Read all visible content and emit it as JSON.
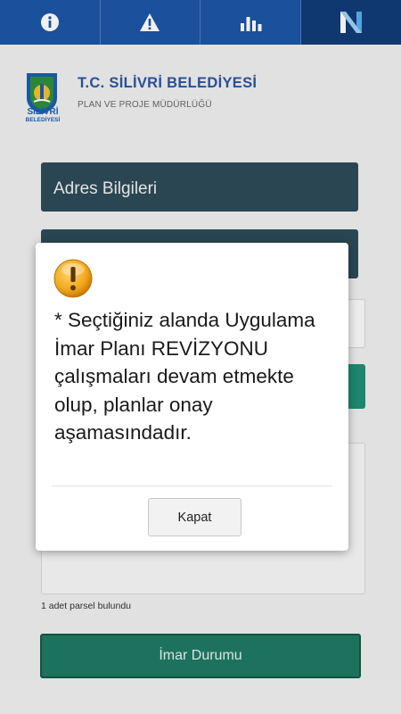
{
  "tabs": [
    {
      "icon": "info-icon"
    },
    {
      "icon": "warning-icon"
    },
    {
      "icon": "bar-chart-icon"
    },
    {
      "icon": "n-logo-icon"
    }
  ],
  "header": {
    "logo_text_top": "SİLİVRİ",
    "logo_text_bottom": "BELEDİYESİ",
    "title": "T.C. SİLİVRİ BELEDİYESİ",
    "subtitle": "PLAN VE PROJE MÜDÜRLÜĞÜ"
  },
  "form": {
    "address_section_label": "Adres Bilgileri",
    "parcel_count": "1 adet parsel bulundu",
    "zoning_button_label": "İmar Durumu"
  },
  "dialog": {
    "icon": "warning-circle-icon",
    "message": "* Seçtiğiniz alanda Uygulama İmar Planı REVİZYONU çalışmaları devam etmekte olup, planlar onay aşamasındadır.",
    "close_label": "Kapat"
  },
  "colors": {
    "tabbar": "#1c56a6",
    "section_bar": "#2d4b59",
    "primary_button": "#1f7a63",
    "title_text": "#2a55a0"
  }
}
